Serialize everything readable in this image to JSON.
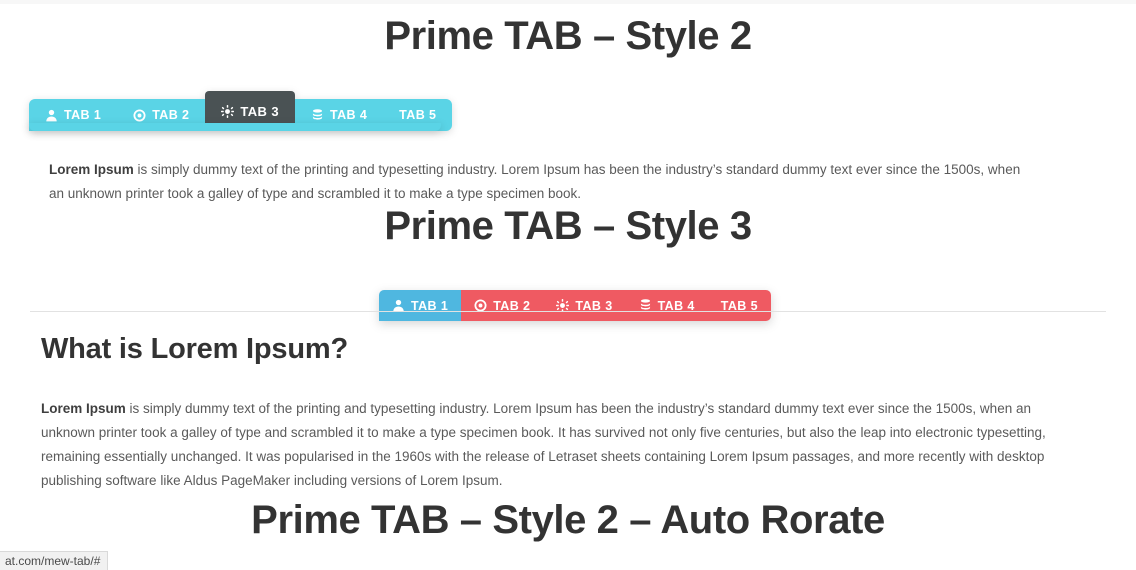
{
  "headings": {
    "style2": "Prime TAB – Style 2",
    "style3": "Prime TAB – Style 3",
    "auto_rotate": "Prime TAB – Style 2 – Auto Rorate",
    "content": "What is Lorem Ipsum?"
  },
  "tabs_style2": {
    "items": [
      {
        "label": "TAB 1",
        "icon": "user-icon",
        "active": false
      },
      {
        "label": "TAB 2",
        "icon": "target-icon",
        "active": false
      },
      {
        "label": "TAB 3",
        "icon": "asterisk-icon",
        "active": true
      },
      {
        "label": "TAB 4",
        "icon": "database-icon",
        "active": false
      },
      {
        "label": "TAB 5",
        "icon": "none",
        "active": false
      }
    ],
    "colors": {
      "tab_bg": "#5ad4e6",
      "active_bg": "#4a5254",
      "text": "#ffffff"
    }
  },
  "tabs_style3": {
    "items": [
      {
        "label": "TAB 1",
        "icon": "user-icon",
        "active": true
      },
      {
        "label": "TAB 2",
        "icon": "target-icon",
        "active": false
      },
      {
        "label": "TAB 3",
        "icon": "asterisk-icon",
        "active": false
      },
      {
        "label": "TAB 4",
        "icon": "database-icon",
        "active": false
      },
      {
        "label": "TAB 5",
        "icon": "none",
        "active": false
      }
    ],
    "colors": {
      "tab_bg": "#ef5a62",
      "active_bg": "#4fb7e0",
      "text": "#ffffff"
    }
  },
  "paragraphs": {
    "style2_lead": "Lorem Ipsum",
    "style2_body": " is simply dummy text of the printing and typesetting industry. Lorem Ipsum has been the industry’s standard dummy text ever since the 1500s, when an unknown printer took a galley of type and scrambled it to make a type specimen book.",
    "content_lead": "Lorem Ipsum",
    "content_body": " is simply dummy text of the printing and typesetting industry. Lorem Ipsum has been the industry’s standard dummy text ever since the 1500s, when an unknown printer took a galley of type and scrambled it to make a type specimen book. It has survived not only five centuries, but also the leap into electronic typesetting, remaining essentially unchanged. It was popularised in the 1960s with the release of Letraset sheets containing Lorem Ipsum passages, and more recently with desktop publishing software like Aldus PageMaker including versions of Lorem Ipsum."
  },
  "status_bar": {
    "url": "at.com/mew-tab/#"
  },
  "theme": {
    "page_bg": "#ffffff",
    "heading_color": "#333333",
    "body_text_color": "#5a5a5a",
    "divider_color": "#e2e2e2"
  }
}
